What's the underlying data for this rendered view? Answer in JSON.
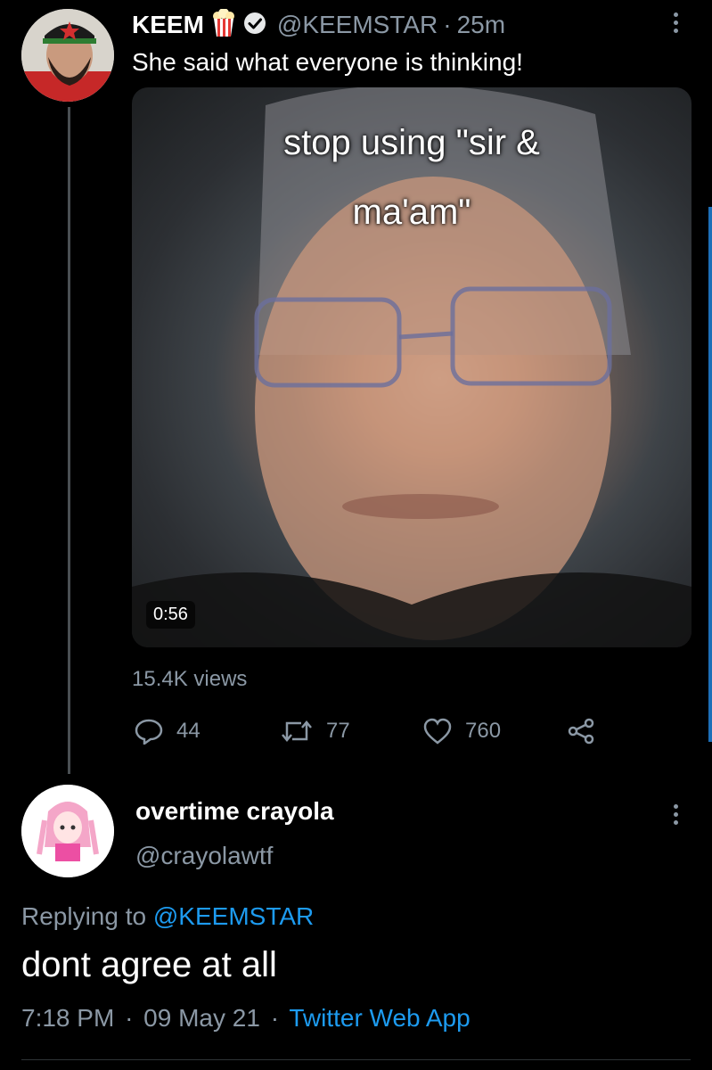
{
  "tweet": {
    "display_name": "KEEM",
    "name_emoji": "popcorn-icon",
    "verified_icon": "verified-badge-icon",
    "handle": "@KEEMSTAR",
    "separator": "·",
    "time_ago": "25m",
    "text": "She said what everyone is thinking!",
    "video": {
      "caption_line1": "stop using \"sir &",
      "caption_line2": "ma'am\"",
      "duration": "0:56"
    },
    "views": "15.4K views",
    "actions": {
      "replies": "44",
      "retweets": "77",
      "likes": "760"
    }
  },
  "reply": {
    "display_name": "overtime crayola",
    "handle": "@crayolawtf",
    "replying_prefix": "Replying to ",
    "replying_to": "@KEEMSTAR",
    "text": "dont agree at all",
    "time": "7:18 PM",
    "date": "09 May 21",
    "source": "Twitter Web App",
    "separator": "·"
  },
  "colors": {
    "background": "#000000",
    "link": "#1d9bf0",
    "muted": "#8b98a5"
  }
}
